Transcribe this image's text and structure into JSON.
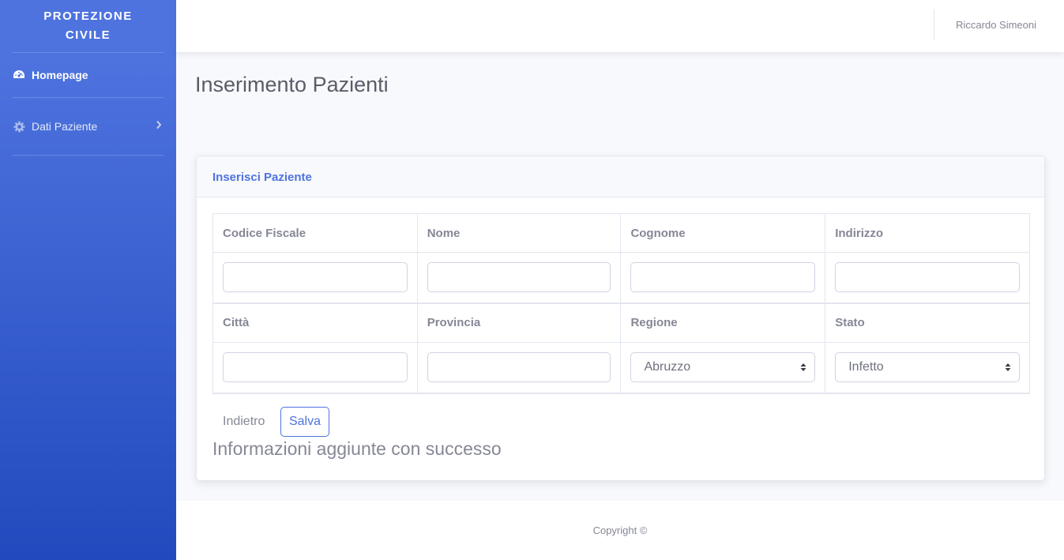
{
  "sidebar": {
    "brand_line1": "PROTEZIONE",
    "brand_line2": "CIVILE",
    "items": [
      {
        "label": "Homepage",
        "icon": "tachometer-icon"
      },
      {
        "label": "Dati Paziente",
        "icon": "gear-icon"
      }
    ]
  },
  "topbar": {
    "user_name": "Riccardo Simeoni"
  },
  "main": {
    "page_title": "Inserimento Pazienti",
    "card_title": "Inserisci Paziente",
    "fields_row1": [
      "Codice Fiscale",
      "Nome",
      "Cognome",
      "Indirizzo"
    ],
    "fields_row2": [
      "Città",
      "Provincia",
      "Regione",
      "Stato"
    ],
    "regione_selected": "Abruzzo",
    "stato_selected": "Infetto",
    "back_label": "Indietro",
    "save_label": "Salva",
    "success_message": "Informazioni aggiunte con successo"
  },
  "footer": {
    "copyright": "Copyright ©"
  },
  "colors": {
    "primary": "#4e73df",
    "sidebar_dark": "#224abe",
    "muted_text": "#858796"
  }
}
